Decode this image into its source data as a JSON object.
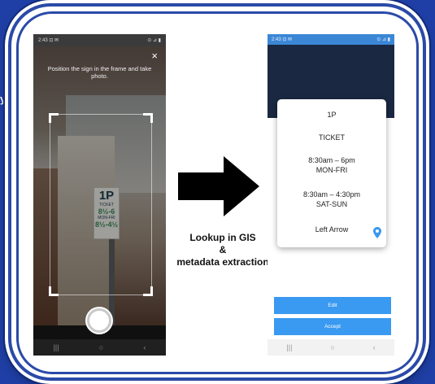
{
  "stray_text": "y",
  "camera_screen": {
    "status_left": "2:43 ⊡ ✉",
    "status_right": "⊙ ⊿ ▮",
    "instruction": "Position the sign in the frame and take photo.",
    "close_glyph": "×",
    "sign": {
      "big": "1P",
      "ticket": "TICKET",
      "time1": "8½-6",
      "time2": "8½-4½",
      "sub": "MON-FRI"
    },
    "nav": [
      "|||",
      "○",
      "‹"
    ]
  },
  "caption": {
    "line1": "Lookup in GIS",
    "line2": "&",
    "line3": "metadata extraction"
  },
  "result_screen": {
    "status_left": "2:43 ⊡ ✉",
    "status_right": "⊙ ⊿ ▮",
    "card": {
      "limit": "1P",
      "type": "TICKET",
      "weekday_hours": "8:30am – 6pm",
      "weekday_days": "MON-FRI",
      "weekend_hours": "8:30am – 4:30pm",
      "weekend_days": "SAT-SUN",
      "direction": "Left Arrow"
    },
    "edit_label": "Edit",
    "accept_label": "Accept",
    "nav": [
      "|||",
      "○",
      "‹"
    ]
  },
  "colors": {
    "background": "#1f3fa6",
    "button": "#3a99f0",
    "pin": "#3a99f0",
    "header": "#1a2842"
  }
}
